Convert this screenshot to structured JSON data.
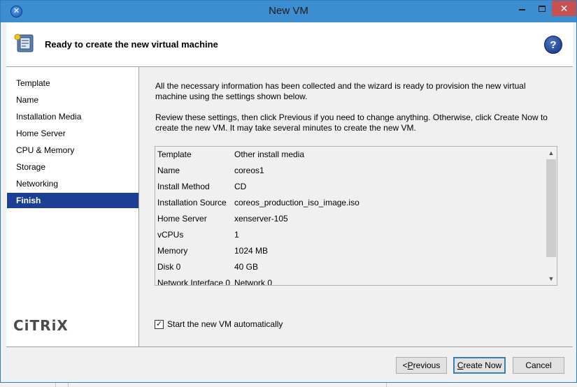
{
  "window": {
    "title": "New VM",
    "close_glyph": "✕"
  },
  "header": {
    "title": "Ready to create the new virtual machine",
    "icon": "vm-wizard-icon",
    "help_label": "?"
  },
  "nav": {
    "items": [
      {
        "label": "Template"
      },
      {
        "label": "Name"
      },
      {
        "label": "Installation Media"
      },
      {
        "label": "Home Server"
      },
      {
        "label": "CPU & Memory"
      },
      {
        "label": "Storage"
      },
      {
        "label": "Networking"
      },
      {
        "label": "Finish",
        "active": true
      }
    ],
    "brand": "CiTRiX"
  },
  "main": {
    "intro": "All the necessary information has been collected and the wizard is ready to provision the new virtual machine using the settings shown below.",
    "review": "Review these settings, then click Previous if you need to change anything. Otherwise, click Create Now to create the new VM. It may take several minutes to create the new VM.",
    "summary": [
      {
        "key": "Template",
        "value": "Other install media"
      },
      {
        "key": "Name",
        "value": "coreos1"
      },
      {
        "key": "Install Method",
        "value": "CD"
      },
      {
        "key": "Installation Source",
        "value": "coreos_production_iso_image.iso"
      },
      {
        "key": "Home Server",
        "value": "xenserver-105"
      },
      {
        "key": "vCPUs",
        "value": "1"
      },
      {
        "key": "Memory",
        "value": "1024 MB"
      },
      {
        "key": "Disk 0",
        "value": "40 GB"
      },
      {
        "key": "Network Interface 0",
        "value": "Network 0"
      }
    ],
    "auto_start": {
      "label": "Start the new VM automatically",
      "checked": true,
      "check_glyph": "✓"
    }
  },
  "footer": {
    "previous_prefix": "< ",
    "previous_access": "P",
    "previous_rest": "revious",
    "create_access": "C",
    "create_rest": "reate Now",
    "cancel_label": "Cancel"
  },
  "colors": {
    "titlebar": "#3d8ed0",
    "nav_active": "#1c3f94",
    "close_button": "#c75050"
  }
}
